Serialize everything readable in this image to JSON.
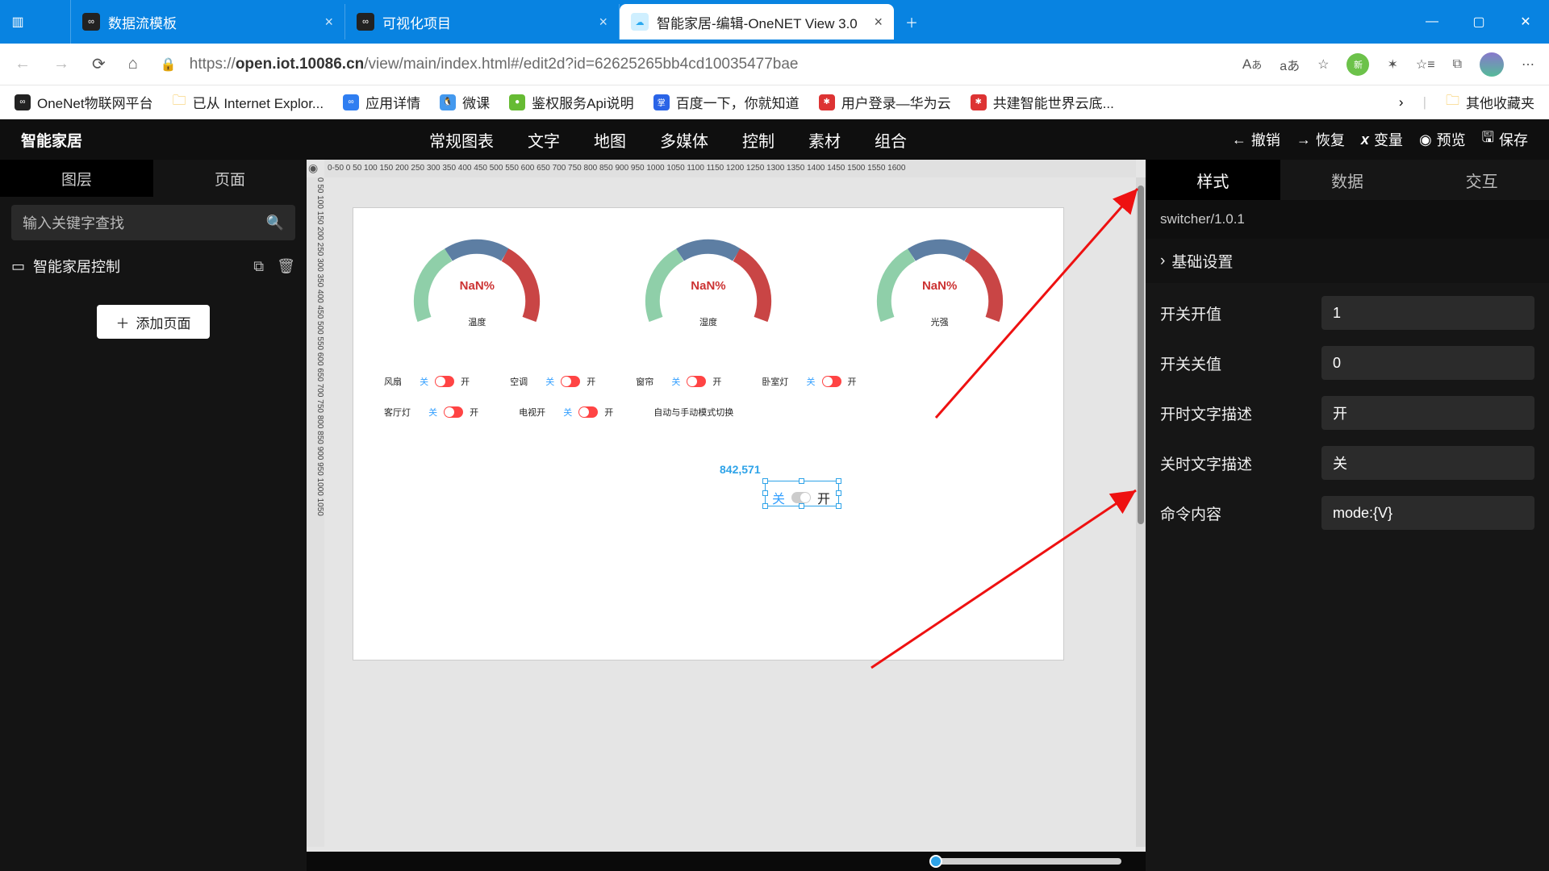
{
  "browser": {
    "tabs": [
      {
        "title": "数据流模板",
        "favicon": "∞"
      },
      {
        "title": "可视化项目",
        "favicon": "∞"
      },
      {
        "title": "智能家居-编辑-OneNET View 3.0",
        "favicon": "☁"
      }
    ],
    "url_prefix": "https://",
    "url_host": "open.iot.10086.cn",
    "url_path": "/view/main/index.html#/edit2d?id=62625265bb4cd10035477bae",
    "addr_icons": {
      "text": "Aあ"
    },
    "bookmarks": [
      {
        "label": "OneNet物联网平台",
        "ico": "∞"
      },
      {
        "label": "已从 Internet Explor...",
        "folder": true
      },
      {
        "label": "应用详情",
        "ico": "∞",
        "cls": "blue"
      },
      {
        "label": "微课",
        "ico": "🐧"
      },
      {
        "label": "鉴权服务Api说明",
        "ico": "●"
      },
      {
        "label": "百度一下，你就知道",
        "ico": "b",
        "cls": "baidu"
      },
      {
        "label": "用户登录—华为云",
        "ico": "✱",
        "cls": "hw"
      },
      {
        "label": "共建智能世界云底...",
        "ico": "✱",
        "cls": "hw"
      }
    ],
    "bookmark_more": "其他收藏夹"
  },
  "app": {
    "title": "智能家居",
    "menus": [
      "常规图表",
      "文字",
      "地图",
      "多媒体",
      "控制",
      "素材",
      "组合"
    ],
    "actions": {
      "undo": "撤销",
      "redo": "恢复",
      "vars": "变量",
      "preview": "预览",
      "save": "保存"
    }
  },
  "left": {
    "tabs": {
      "layers": "图层",
      "pages": "页面"
    },
    "search_placeholder": "输入关键字查找",
    "layer_item": "智能家居控制",
    "add_page": "添加页面"
  },
  "canvas": {
    "ruler_h": "0-50 0 50 100 150 200 250 300 350 400 450 500 550 600 650 700 750 800 850 900 950 1000 1050 1100 1150 1200 1250 1300 1350 1400 1450 1500 1550 1600",
    "ruler_v": "0 50 100 150 200 250 300 350 400 450 500 550 600 650 700 750 800 850 900 950 1000 1050",
    "coord": "842,571",
    "gauges": [
      {
        "value": "NaN%",
        "caption": "温度"
      },
      {
        "value": "NaN%",
        "caption": "湿度"
      },
      {
        "value": "NaN%",
        "caption": "光强"
      }
    ],
    "switch_lbl_off": "关",
    "switch_lbl_on": "开",
    "row1": [
      {
        "label": "风扇"
      },
      {
        "label": "空调"
      },
      {
        "label": "窗帘"
      },
      {
        "label": "卧室灯"
      }
    ],
    "row2": [
      {
        "label": "客厅灯"
      },
      {
        "label": "电视开",
        "sub": "–"
      },
      {
        "label": "自动与手动模式切换"
      }
    ]
  },
  "right": {
    "tabs": {
      "style": "样式",
      "data": "数据",
      "interact": "交互"
    },
    "component_id": "switcher/1.0.1",
    "section": "基础设置",
    "props": {
      "on_value_label": "开关开值",
      "on_value": "1",
      "off_value_label": "开关关值",
      "off_value": "0",
      "on_text_label": "开时文字描述",
      "on_text": "开",
      "off_text_label": "关时文字描述",
      "off_text": "关",
      "cmd_label": "命令内容",
      "cmd": "mode:{V}"
    }
  }
}
